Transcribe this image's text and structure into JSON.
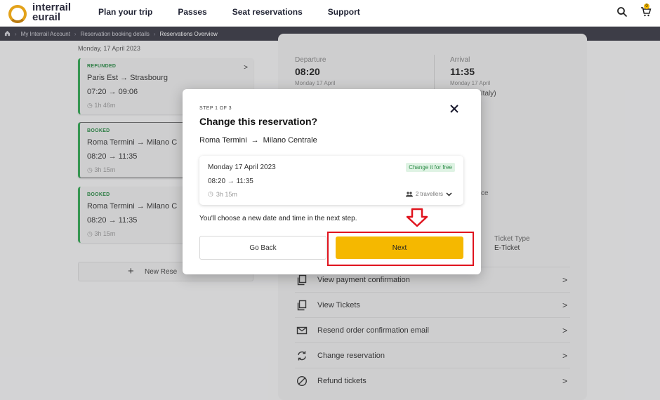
{
  "header": {
    "logo_text_line1": "interrail",
    "logo_text_line2": "eurail",
    "nav": [
      "Plan your trip",
      "Passes",
      "Seat reservations",
      "Support"
    ],
    "cart_count": "0"
  },
  "breadcrumb": [
    "My Interrail Account",
    "Reservation booking details",
    "Reservations Overview"
  ],
  "left": {
    "date_label": "Monday, 17 April 2023",
    "cards": [
      {
        "status": "REFUNDED",
        "route": "Paris Est  →  Strasbourg",
        "times": "07:20  →  09:06",
        "duration": "1h 46m"
      },
      {
        "status": "BOOKED",
        "route": "Roma Termini  →  Milano C",
        "times": "08:20  →  11:35",
        "duration": "3h 15m"
      },
      {
        "status": "BOOKED",
        "route": "Roma Termini  →  Milano C",
        "times": "08:20  →  11:35",
        "duration": "3h 15m"
      }
    ],
    "new_reservation": "New Rese"
  },
  "right": {
    "departure_label": "Departure",
    "departure_time": "08:20",
    "departure_date": "Monday 17 April",
    "arrival_label": "Arrival",
    "arrival_time": "11:35",
    "arrival_date": "Monday 17 April",
    "arrival_station": "Centrale (Italy)",
    "fragment": "ce",
    "ticket_type_label": "Ticket Type",
    "ticket_type_value": "E-Ticket",
    "actions": [
      {
        "label": "View payment confirmation",
        "icon": "copy-icon"
      },
      {
        "label": "View Tickets",
        "icon": "copy-icon"
      },
      {
        "label": "Resend order confirmation email",
        "icon": "mail-icon"
      },
      {
        "label": "Change reservation",
        "icon": "refresh-icon"
      },
      {
        "label": "Refund tickets",
        "icon": "cancel-icon"
      }
    ]
  },
  "modal": {
    "step": "STEP 1 OF 3",
    "title": "Change this reservation?",
    "from": "Roma Termini",
    "to": "Milano Centrale",
    "date": "Monday 17 April 2023",
    "badge": "Change it for free",
    "times": "08:20  →  11:35",
    "duration": "3h 15m",
    "travellers": "2 travellers",
    "note": "You'll choose a new date and time in the next step.",
    "back_label": "Go Back",
    "next_label": "Next"
  },
  "colors": {
    "accent": "#f5b800",
    "booked_green": "#34a853",
    "annotation_red": "#e0141e"
  }
}
